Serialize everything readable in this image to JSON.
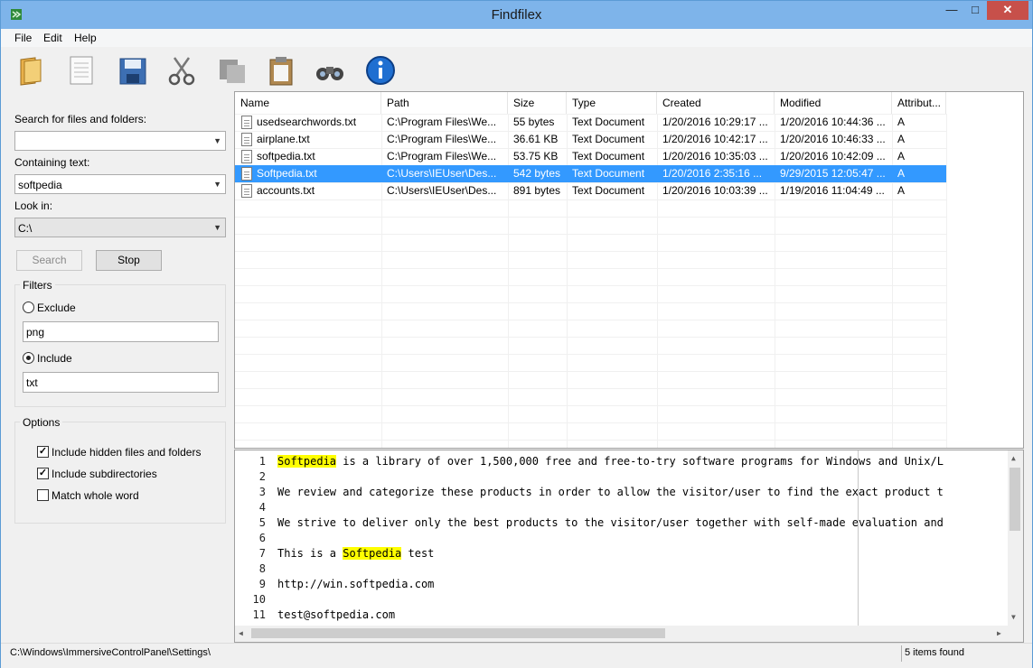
{
  "window": {
    "title": "Findfilex"
  },
  "menu": [
    "File",
    "Edit",
    "Help"
  ],
  "toolbar": {
    "icons": [
      "open-folder-icon",
      "new-document-icon",
      "save-icon",
      "cut-icon",
      "copy-icon",
      "paste-icon",
      "find-icon",
      "info-icon"
    ]
  },
  "search_panel": {
    "search_label": "Search for files and folders:",
    "search_value": "",
    "containing_label": "Containing text:",
    "containing_value": "softpedia",
    "look_in_label": "Look in:",
    "look_in_value": "C:\\",
    "search_button": "Search",
    "stop_button": "Stop"
  },
  "filters": {
    "title": "Filters",
    "exclude_label": "Exclude",
    "exclude_value": "png",
    "include_label": "Include",
    "include_value": "txt",
    "selected": "include"
  },
  "options": {
    "title": "Options",
    "items": [
      {
        "label": "Include hidden files and folders",
        "checked": true
      },
      {
        "label": "Include subdirectories",
        "checked": true
      },
      {
        "label": "Match whole word",
        "checked": false
      }
    ]
  },
  "results": {
    "columns": [
      "Name",
      "Path",
      "Size",
      "Type",
      "Created",
      "Modified",
      "Attribut..."
    ],
    "rows": [
      {
        "name": "usedsearchwords.txt",
        "path": "C:\\Program Files\\We...",
        "size": "55 bytes",
        "type": "Text Document",
        "created": "1/20/2016 10:29:17 ...",
        "modified": "1/20/2016 10:44:36 ...",
        "attr": "A",
        "selected": false
      },
      {
        "name": "airplane.txt",
        "path": "C:\\Program Files\\We...",
        "size": "36.61 KB",
        "type": "Text Document",
        "created": "1/20/2016 10:42:17 ...",
        "modified": "1/20/2016 10:46:33 ...",
        "attr": "A",
        "selected": false
      },
      {
        "name": "softpedia.txt",
        "path": "C:\\Program Files\\We...",
        "size": "53.75 KB",
        "type": "Text Document",
        "created": "1/20/2016 10:35:03 ...",
        "modified": "1/20/2016 10:42:09 ...",
        "attr": "A",
        "selected": false
      },
      {
        "name": "Softpedia.txt",
        "path": "C:\\Users\\IEUser\\Des...",
        "size": "542 bytes",
        "type": "Text Document",
        "created": "1/20/2016 2:35:16 ...",
        "modified": "9/29/2015 12:05:47 ...",
        "attr": "A",
        "selected": true
      },
      {
        "name": "accounts.txt",
        "path": "C:\\Users\\IEUser\\Des...",
        "size": "891 bytes",
        "type": "Text Document",
        "created": "1/20/2016 10:03:39 ...",
        "modified": "1/19/2016 11:04:49 ...",
        "attr": "A",
        "selected": false
      }
    ]
  },
  "preview": {
    "lines": [
      {
        "n": "1",
        "parts": [
          {
            "t": "Softpedia",
            "hl": true
          },
          {
            "t": " is a library of over 1,500,000 free and free-to-try software programs for Windows and Unix/L"
          }
        ]
      },
      {
        "n": "2",
        "parts": []
      },
      {
        "n": "3",
        "parts": [
          {
            "t": "We review and categorize these products in order to allow the visitor/user to find the exact product t"
          }
        ]
      },
      {
        "n": "4",
        "parts": []
      },
      {
        "n": "5",
        "parts": [
          {
            "t": "We strive to deliver only the best products to the visitor/user together with self-made evaluation and"
          }
        ]
      },
      {
        "n": "6",
        "parts": []
      },
      {
        "n": "7",
        "parts": [
          {
            "t": "This is a "
          },
          {
            "t": "Softpedia",
            "hl": true
          },
          {
            "t": " test"
          }
        ]
      },
      {
        "n": "8",
        "parts": []
      },
      {
        "n": "9",
        "parts": [
          {
            "t": "http://win.softpedia.com"
          }
        ]
      },
      {
        "n": "10",
        "parts": []
      },
      {
        "n": "11",
        "parts": [
          {
            "t": "test@softpedia.com"
          }
        ]
      }
    ]
  },
  "status": {
    "path": "C:\\Windows\\ImmersiveControlPanel\\Settings\\",
    "count": "5 items found"
  },
  "colors": {
    "titlebar": "#7eb4ea",
    "selection": "#3399ff",
    "highlight": "#ffff00",
    "close": "#c7504a"
  }
}
